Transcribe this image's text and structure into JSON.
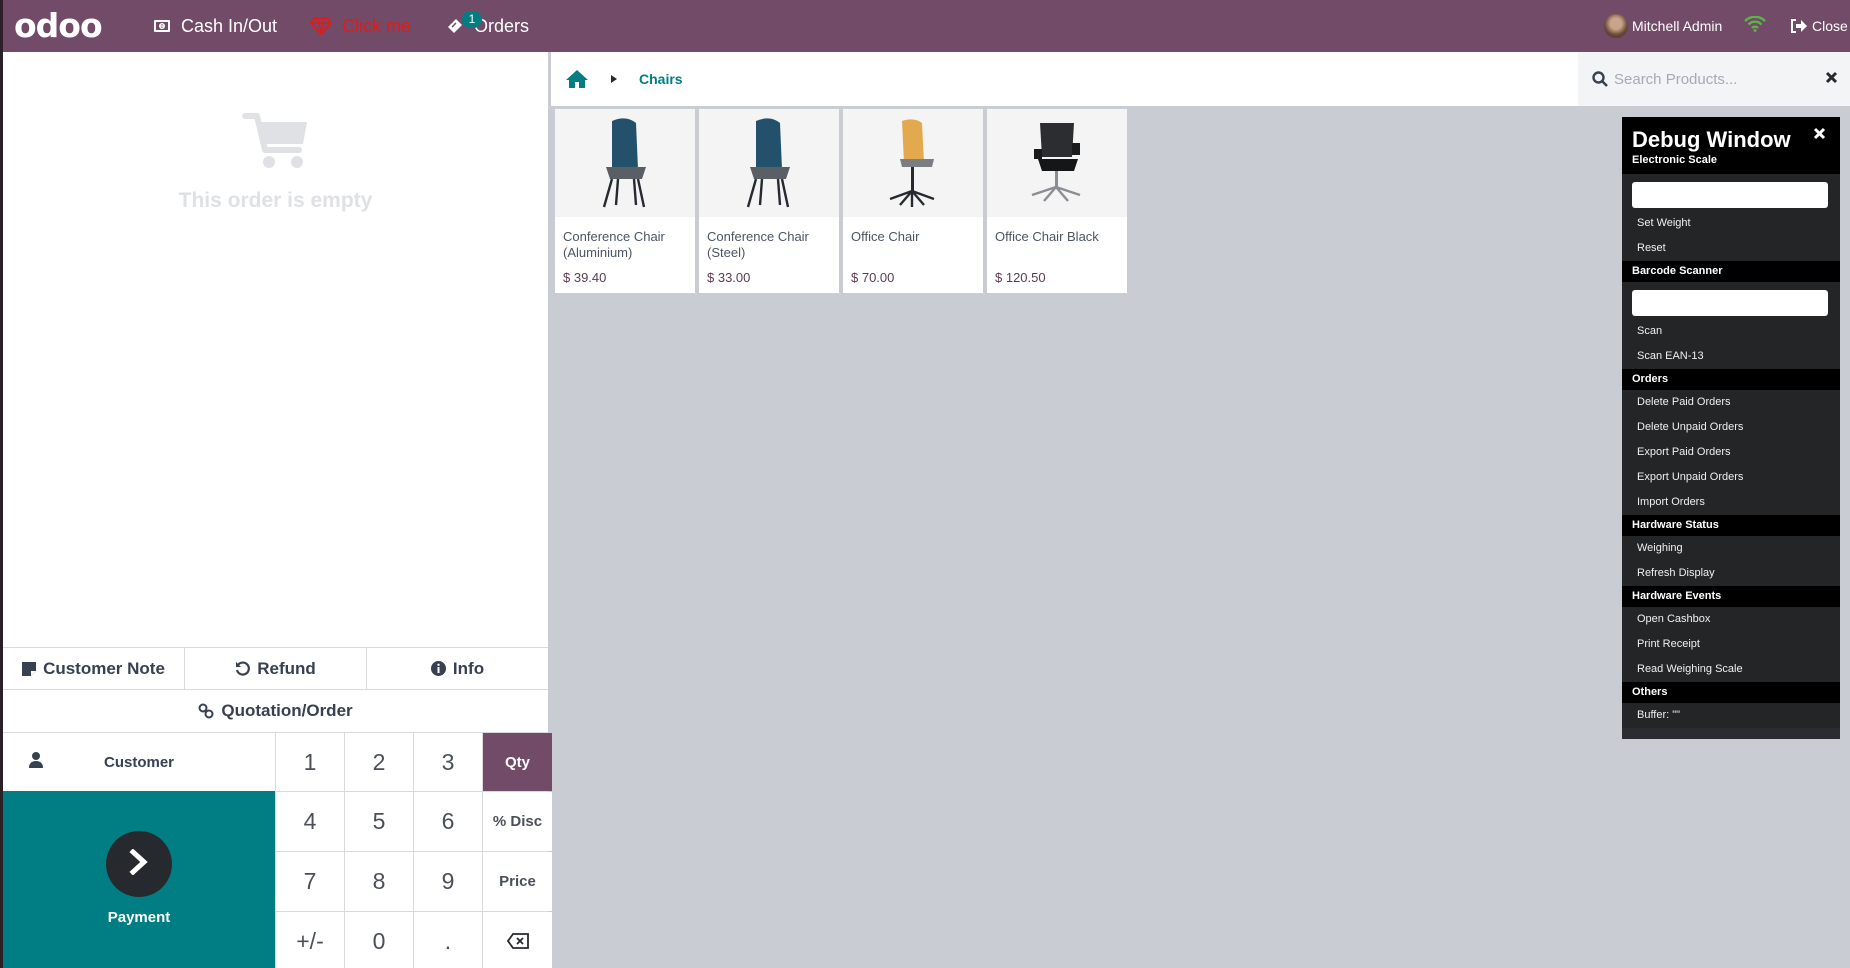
{
  "header": {
    "logo": "odoo",
    "cash_in_out": "Cash In/Out",
    "click_me": "Click me",
    "orders": "Orders",
    "orders_badge": "1",
    "user_name": "Mitchell Admin",
    "close": "Close",
    "colors": {
      "brand": "#714B67",
      "click_me": "#E01B1B",
      "wifi": "#5DB346",
      "badge": "#017E84"
    }
  },
  "order": {
    "empty_text": "This order is empty"
  },
  "actions": {
    "customer_note": "Customer Note",
    "refund": "Refund",
    "info": "Info",
    "quotation": "Quotation/Order"
  },
  "control": {
    "customer": "Customer",
    "payment": "Payment",
    "numpad": [
      "1",
      "2",
      "3",
      "Qty",
      "4",
      "5",
      "6",
      "% Disc",
      "7",
      "8",
      "9",
      "Price",
      "+/-",
      "0",
      ".",
      "backspace"
    ],
    "active_mode": "Qty"
  },
  "breadcrumb": {
    "home": "home-icon",
    "items": [
      "Chairs"
    ]
  },
  "search": {
    "placeholder": "Search Products...",
    "value": ""
  },
  "products": [
    {
      "name": "Conference Chair (Aluminium)",
      "price": "$ 39.40",
      "image": "blue-chair"
    },
    {
      "name": "Conference Chair (Steel)",
      "price": "$ 33.00",
      "image": "blue-chair"
    },
    {
      "name": "Office Chair",
      "price": "$ 70.00",
      "image": "orange-swivel-chair"
    },
    {
      "name": "Office Chair Black",
      "price": "$ 120.50",
      "image": "black-mesh-chair"
    }
  ],
  "debug": {
    "title": "Debug Window",
    "sections": [
      {
        "title": "Electronic Scale",
        "input": true,
        "items": [
          "Set Weight",
          "Reset"
        ]
      },
      {
        "title": "Barcode Scanner",
        "input": true,
        "items": [
          "Scan",
          "Scan EAN-13"
        ]
      },
      {
        "title": "Orders",
        "input": false,
        "items": [
          "Delete Paid Orders",
          "Delete Unpaid Orders",
          "Export Paid Orders",
          "Export Unpaid Orders",
          "Import Orders"
        ]
      },
      {
        "title": "Hardware Status",
        "input": false,
        "items": [
          "Weighing",
          "Refresh Display"
        ]
      },
      {
        "title": "Hardware Events",
        "input": false,
        "items": [
          "Open Cashbox",
          "Print Receipt",
          "Read Weighing Scale"
        ]
      },
      {
        "title": "Others",
        "input": false,
        "items": [
          "Buffer: \"\""
        ]
      }
    ]
  }
}
